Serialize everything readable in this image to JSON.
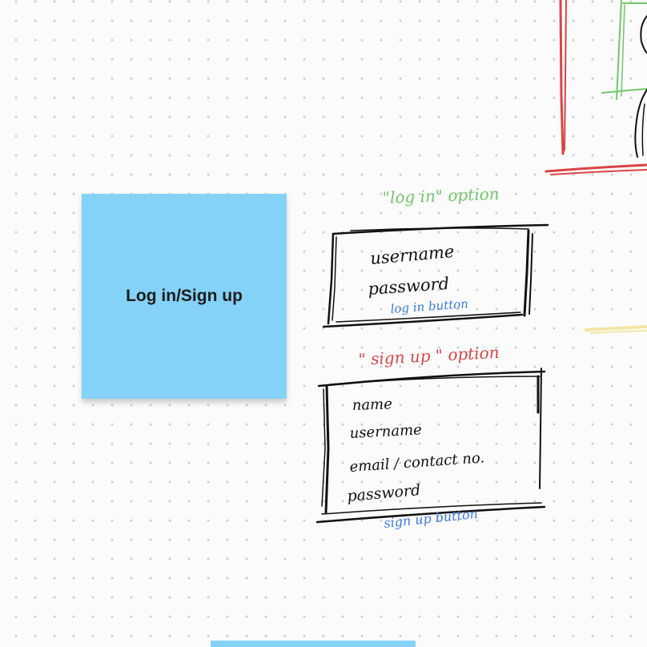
{
  "colors": {
    "sticky_blue": "#85d2f8",
    "ink_black": "#111111",
    "ink_green": "#72c66a",
    "ink_red": "#d94545",
    "ink_blue": "#3a7be0",
    "ink_yellow": "#f3e6a3"
  },
  "sticky_note": {
    "label": "Log in/Sign up"
  },
  "login_sketch": {
    "heading": "\"log in\" option",
    "fields": [
      "username",
      "password"
    ],
    "button_label": "log in button"
  },
  "signup_sketch": {
    "heading": "\" sign up \" option",
    "fields": [
      "name",
      "username",
      "email / contact no.",
      "password"
    ],
    "button_label": "sign up button"
  }
}
